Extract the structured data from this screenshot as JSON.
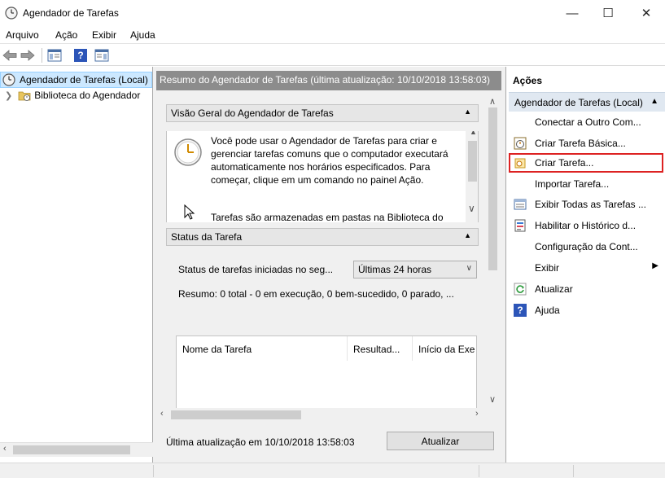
{
  "window": {
    "title": "Agendador de Tarefas",
    "controls": {
      "minimize": "—",
      "maximize": "☐",
      "close": "✕"
    }
  },
  "menu": [
    "Arquivo",
    "Ação",
    "Exibir",
    "Ajuda"
  ],
  "toolbar": {
    "icons": [
      "back-arrow-icon",
      "forward-arrow-icon",
      "show-console-tree-icon",
      "help-icon",
      "show-action-pane-icon"
    ],
    "help_glyph": "?"
  },
  "tree": {
    "items": [
      {
        "label": "Agendador de Tarefas (Local)",
        "selected": true
      },
      {
        "label": "Biblioteca do Agendador",
        "selected": false
      }
    ]
  },
  "center": {
    "header": "Resumo do Agendador de Tarefas (última atualização: 10/10/2018 13:58:03)",
    "overview": {
      "title": "Visão Geral do Agendador de Tarefas",
      "text": "Você pode usar o Agendador de Tarefas para criar e gerenciar tarefas comuns que o computador executará automaticamente nos horários especificados. Para começar, clique em um comando no painel Ação.",
      "text2": "Tarefas são armazenadas em pastas na Biblioteca do"
    },
    "status": {
      "title": "Status da Tarefa",
      "filter_label": "Status de tarefas iniciadas no seg...",
      "filter_value": "Últimas 24 horas",
      "summary": "Resumo: 0 total - 0 em execução, 0 bem-sucedido, 0 parado, ...",
      "columns": [
        "Nome da Tarefa",
        "Resultad...",
        "Início da Exe"
      ]
    },
    "last_update": "Última atualização em 10/10/2018 13:58:03",
    "refresh_button": "Atualizar"
  },
  "actions": {
    "title": "Ações",
    "group": "Agendador de Tarefas (Local)",
    "items": [
      {
        "label": "Conectar a Outro Com...",
        "icon": ""
      },
      {
        "label": "Criar Tarefa Básica...",
        "icon": "basic-task-icon"
      },
      {
        "label": "Criar Tarefa...",
        "icon": "create-task-icon",
        "highlighted": true
      },
      {
        "label": "Importar Tarefa...",
        "icon": ""
      },
      {
        "label": "Exibir Todas as Tarefas ...",
        "icon": "view-tasks-icon"
      },
      {
        "label": "Habilitar o Histórico d...",
        "icon": "history-icon"
      },
      {
        "label": "Configuração da Cont...",
        "icon": ""
      },
      {
        "label": "Exibir",
        "icon": "",
        "submenu": true
      },
      {
        "label": "Atualizar",
        "icon": "refresh-icon"
      },
      {
        "label": "Ajuda",
        "icon": "help-icon"
      }
    ]
  },
  "colors": {
    "selection": "#cce8ff",
    "center_header": "#8c8c8c",
    "actions_group": "#e0e8f1",
    "highlight_border": "#dd2222"
  }
}
